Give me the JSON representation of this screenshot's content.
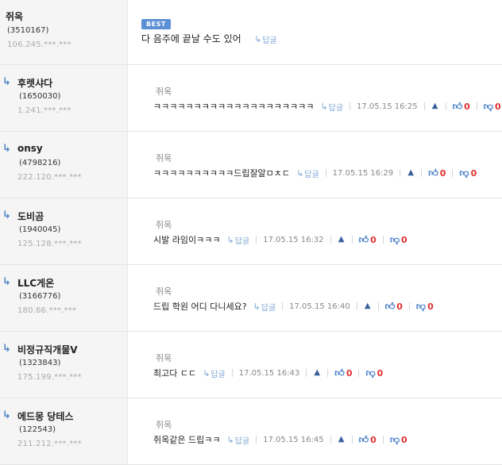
{
  "best": {
    "author": "쥐옥",
    "uid": "(3510167)",
    "ip": "106.245.***.***",
    "badge": "BEST",
    "text": "다 음주에 끝날 수도 있어",
    "reply_label": "답글"
  },
  "reply_label": "답글",
  "replies": [
    {
      "author": "후렛샤다",
      "uid": "(1650030)",
      "ip": "1.241.***.***",
      "to": "쥐옥",
      "text": "ㅋㅋㅋㅋㅋㅋㅋㅋㅋㅋㅋㅋㅋㅋㅋㅋㅋㅋㅋㅋ",
      "date": "17.05.15 16:25",
      "up": "0",
      "down": "0"
    },
    {
      "author": "onsy",
      "uid": "(4798216)",
      "ip": "222.120.***.***",
      "to": "쥐옥",
      "text": "ㅋㅋㅋㅋㅋㅋㅋㅋㅋㅋ드립잘알ㅁㅊㄷ",
      "date": "17.05.15 16:29",
      "up": "0",
      "down": "0"
    },
    {
      "author": "도비곰",
      "uid": "(1940045)",
      "ip": "125.128.***.***",
      "to": "쥐옥",
      "text": "시발 라임이ㅋㅋㅋ",
      "date": "17.05.15 16:32",
      "up": "0",
      "down": "0"
    },
    {
      "author": "LLC게온",
      "uid": "(3166776)",
      "ip": "180.66.***.***",
      "to": "쥐옥",
      "text": "드립 학원 어디 다니세요?",
      "date": "17.05.15 16:40",
      "up": "0",
      "down": "0"
    },
    {
      "author": "비정규직개물V",
      "uid": "(1323843)",
      "ip": "175.199.***.***",
      "to": "쥐옥",
      "text": "최고다 ㄷㄷ",
      "date": "17.05.15 16:43",
      "up": "0",
      "down": "0"
    },
    {
      "author": "에드몽 당테스",
      "uid": "(122543)",
      "ip": "211.212.***.***",
      "to": "쥐옥",
      "text": "쥐옥같은 드립ㅋㅋ",
      "date": "17.05.15 16:45",
      "up": "0",
      "down": "0"
    }
  ],
  "icons": {
    "reply_arrow": "reply-arrow-icon",
    "bell": "bell-icon",
    "thumb_up": "thumbs-up-icon",
    "thumb_down": "thumbs-down-icon"
  },
  "colors": {
    "badge": "#5b8fd6",
    "count": "#e03030",
    "accent": "#3f79c6"
  }
}
